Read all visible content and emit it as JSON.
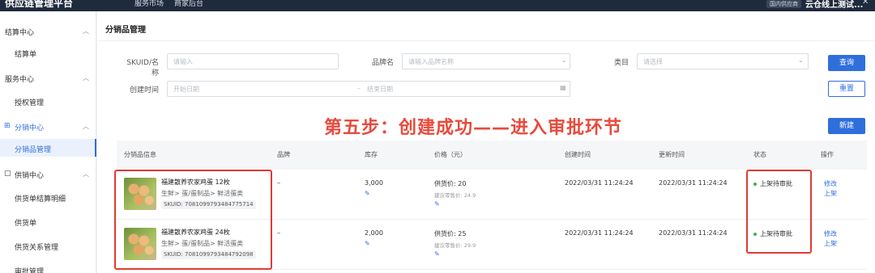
{
  "topbar": {
    "app_title": "供应链管理平台",
    "nav": [
      "服务市场",
      "商家后台"
    ],
    "tag": "国内供应商",
    "company": "云仓线上测试...",
    "close_glyph": "✕"
  },
  "sidebar": {
    "groups": [
      {
        "label": "结算中心",
        "items": [
          "结算单"
        ]
      },
      {
        "label": "服务中心",
        "items": [
          "授权管理"
        ]
      },
      {
        "label": "分销中心",
        "items": [
          "分销品管理"
        ],
        "active": true
      },
      {
        "label": "供销中心",
        "items": [
          "供货单结算明细",
          "供货单",
          "供货关系管理",
          "审批管理"
        ]
      }
    ]
  },
  "page": {
    "title": "分销品管理"
  },
  "filters": {
    "sku_label": "SKUID/名称",
    "sku_placeholder": "请输入",
    "brand_label": "品牌名",
    "brand_placeholder": "请输入品牌名称",
    "category_label": "类目",
    "category_placeholder": "请选择",
    "created_label": "创建时间",
    "start_placeholder": "开始日期",
    "range_sep": "–",
    "end_placeholder": "结束日期",
    "query_button": "查询",
    "reset_button": "重置",
    "new_button": "新建"
  },
  "annotation": "第五步：创建成功——进入审批环节",
  "table": {
    "headers": [
      "分销品信息",
      "品牌",
      "库存",
      "价格（元）",
      "创建时间",
      "更新时间",
      "状态",
      "操作"
    ],
    "rows": [
      {
        "name": "福建散养农家鸡蛋 12枚",
        "category": "生鲜> 蛋/蛋制品> 鲜活蛋类",
        "sku": "SKUID: 7081099793484775714",
        "brand": "–",
        "stock": "3,000",
        "supply_price": "供货价: 20",
        "retail_price": "建议零售价: 24.9",
        "created": "2022/03/31 11:24:24",
        "updated": "2022/03/31 11:24:24",
        "status": "上架待审批",
        "actions": [
          "修改",
          "上架"
        ]
      },
      {
        "name": "福建散养农家鸡蛋 24枚",
        "category": "生鲜> 蛋/蛋制品> 鲜活蛋类",
        "sku": "SKUID: 7081099793484792098",
        "brand": "–",
        "stock": "2,000",
        "supply_price": "供货价: 25",
        "retail_price": "建议零售价: 29.9",
        "created": "2022/03/31 11:24:24",
        "updated": "2022/03/31 11:24:24",
        "status": "上架待审批",
        "actions": [
          "修改",
          "上架"
        ]
      }
    ]
  },
  "colors": {
    "accent": "#2f6fdc",
    "annotation": "#e84a3c",
    "status_dot": "#3bb35c"
  }
}
